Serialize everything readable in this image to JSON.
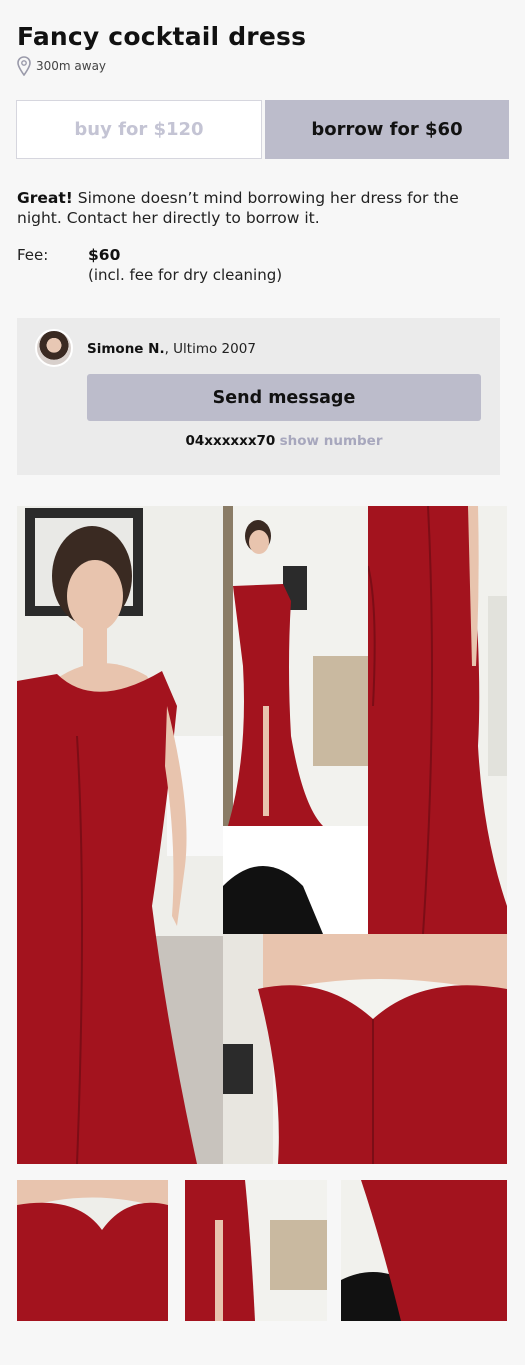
{
  "listing": {
    "title": "Fancy cocktail dress",
    "distance": "300m away",
    "location_icon": "map-pin-icon"
  },
  "actions": {
    "buy_label": "buy for $120",
    "borrow_label": "borrow for $60"
  },
  "message": {
    "lead": "Great!",
    "body": " Simone doesn’t mind borrowing her dress for the night. Contact her directly to borrow it."
  },
  "fee": {
    "label": "Fee:",
    "amount": "$60",
    "note": "(incl. fee for dry cleaning)"
  },
  "seller": {
    "name": "Simone N.",
    "details": ", Ultimo 2007",
    "send_label": "Send message",
    "phone": "04xxxxxx70",
    "show_number": "show number"
  },
  "colors": {
    "accent": "#bcbccb",
    "dress_red": "#a3131e",
    "muted_link": "#a7a7bd"
  }
}
